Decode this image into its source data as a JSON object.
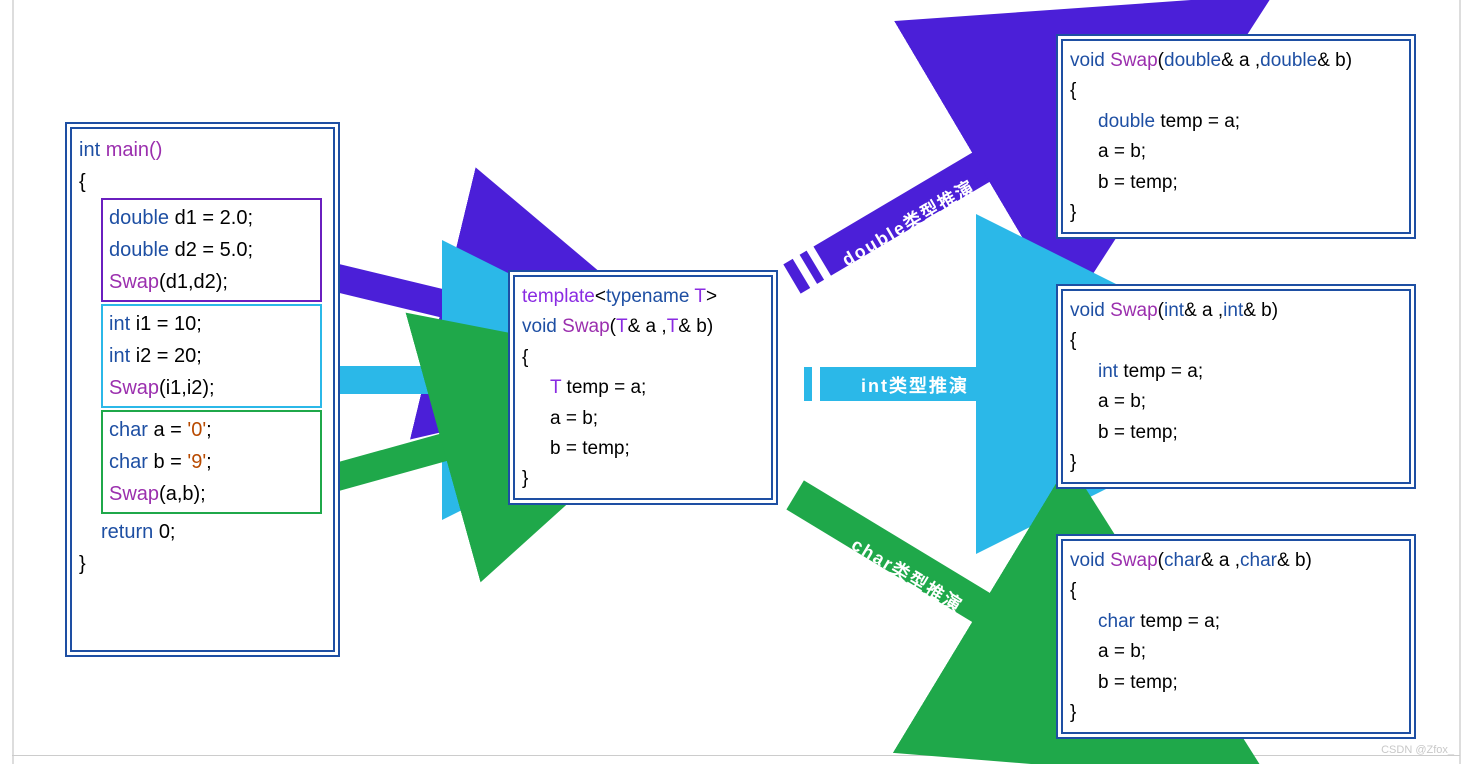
{
  "main_box": {
    "l1": "int",
    "l1b": "main()",
    "brace_open": "{",
    "double_block": {
      "d1a": "double",
      "d1b": "d1 = 2.0;",
      "d2a": "double",
      "d2b": "d2 = 5.0;",
      "s": "Swap",
      "sb": "(d1,d2);"
    },
    "int_block": {
      "i1a": "int",
      "i1b": "i1 = 10;",
      "i2a": "int",
      "i2b": "i2 = 20;",
      "s": "Swap",
      "sb": "(i1,i2);"
    },
    "char_block": {
      "c1a": "char",
      "c1b": "a = ",
      "c1c": "'0'",
      "c1d": ";",
      "c2a": "char",
      "c2b": "b = ",
      "c2c": "'9'",
      "c2d": ";",
      "s": "Swap",
      "sb": "(a,b);"
    },
    "ret_a": "return",
    "ret_b": "0;",
    "brace_close": "}"
  },
  "template_box": {
    "t1a": "template",
    "t1b": "<",
    "t1c": "typename",
    "t1d": "T",
    "t1e": ">",
    "t2a": "void",
    "t2b": "Swap",
    "t2c": "(",
    "t2d": "T",
    "t2e": "& a ,",
    "t2f": "T",
    "t2g": "& b)",
    "brace_open": "{",
    "body1a": "T",
    "body1b": " temp = a;",
    "body2": "a = b;",
    "body3": "b = temp;",
    "brace_close": "}"
  },
  "double_out": {
    "h1a": "void",
    "h1b": "Swap",
    "h1c": "(",
    "h1d": "double",
    "h1e": "& a ,",
    "h1f": "double",
    "h1g": "& b)",
    "brace_open": "{",
    "b1a": "double",
    "b1b": " temp = a;",
    "b2": "a = b;",
    "b3": "b = temp;",
    "brace_close": "}"
  },
  "int_out": {
    "h1a": "void",
    "h1b": "Swap",
    "h1c": "(",
    "h1d": "int",
    "h1e": "& a ,",
    "h1f": "int",
    "h1g": "& b)",
    "brace_open": "{",
    "b1a": "int",
    "b1b": " temp = a;",
    "b2": "a = b;",
    "b3": "b = temp;",
    "brace_close": "}"
  },
  "char_out": {
    "h1a": "void",
    "h1b": "Swap",
    "h1c": "(",
    "h1d": "char",
    "h1e": "& a ,",
    "h1f": "char",
    "h1g": "& b)",
    "brace_open": "{",
    "b1a": "char",
    "b1b": " temp = a;",
    "b2": "a = b;",
    "b3": "b = temp;",
    "brace_close": "}"
  },
  "labels": {
    "double": "double类型推演",
    "int": "int类型推演",
    "char": "char类型推演"
  },
  "watermark": "CSDN @Zfox_"
}
